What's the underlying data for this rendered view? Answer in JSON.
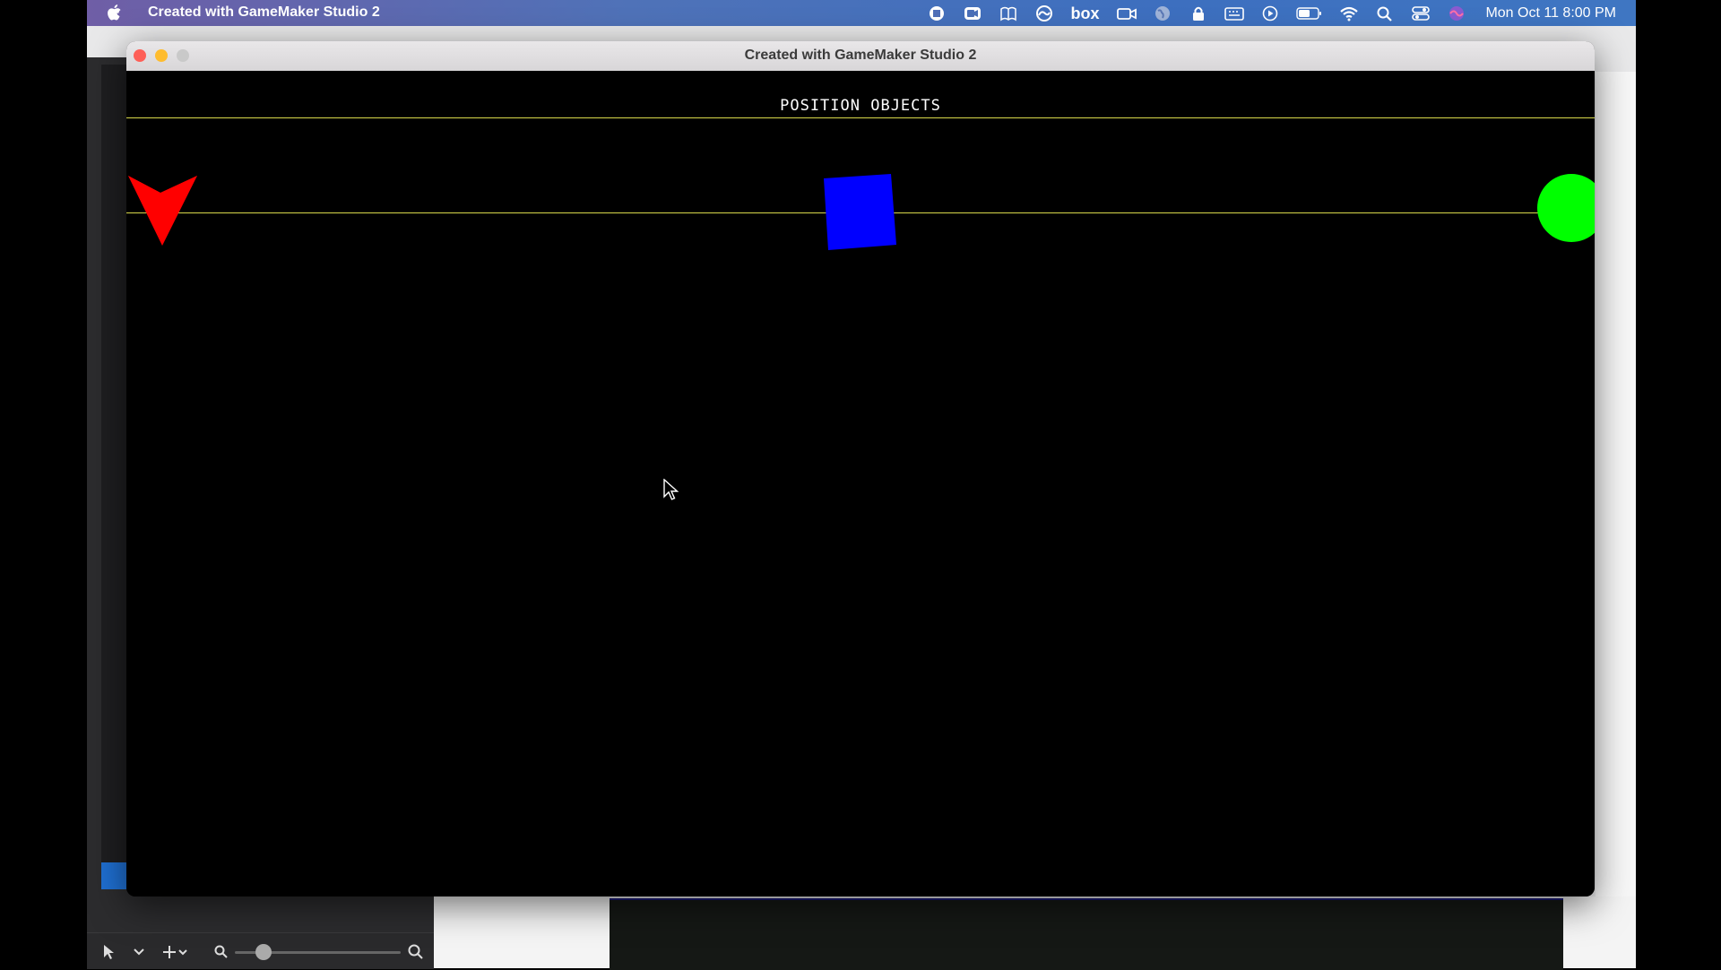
{
  "menubar": {
    "app_name": "Created with GameMaker Studio 2",
    "clock": "Mon Oct 11  8:00 PM",
    "tray_icons": [
      "screen-record-icon",
      "zoom-icon",
      "books-icon",
      "creative-cloud-icon",
      "box-icon",
      "facetime-icon",
      "globe-icon",
      "lock-icon",
      "keyboard-icon",
      "play-icon",
      "battery-icon",
      "wifi-icon",
      "spotlight-search-icon",
      "control-center-icon",
      "siri-icon"
    ],
    "tray_text": {
      "box": "box"
    }
  },
  "window": {
    "title": "Created with GameMaker Studio 2"
  },
  "game": {
    "heading": "POSITION OBJECTS",
    "objects": [
      {
        "name": "red-arrow",
        "color": "#ff0000"
      },
      {
        "name": "blue-square",
        "color": "#0000ff"
      },
      {
        "name": "green-circle",
        "color": "#00ff00"
      }
    ],
    "line_color": "#d8d84a"
  },
  "colors": {
    "close": "#fe5f57",
    "minimize": "#febc2e",
    "zoom": "#c9c9c9"
  }
}
